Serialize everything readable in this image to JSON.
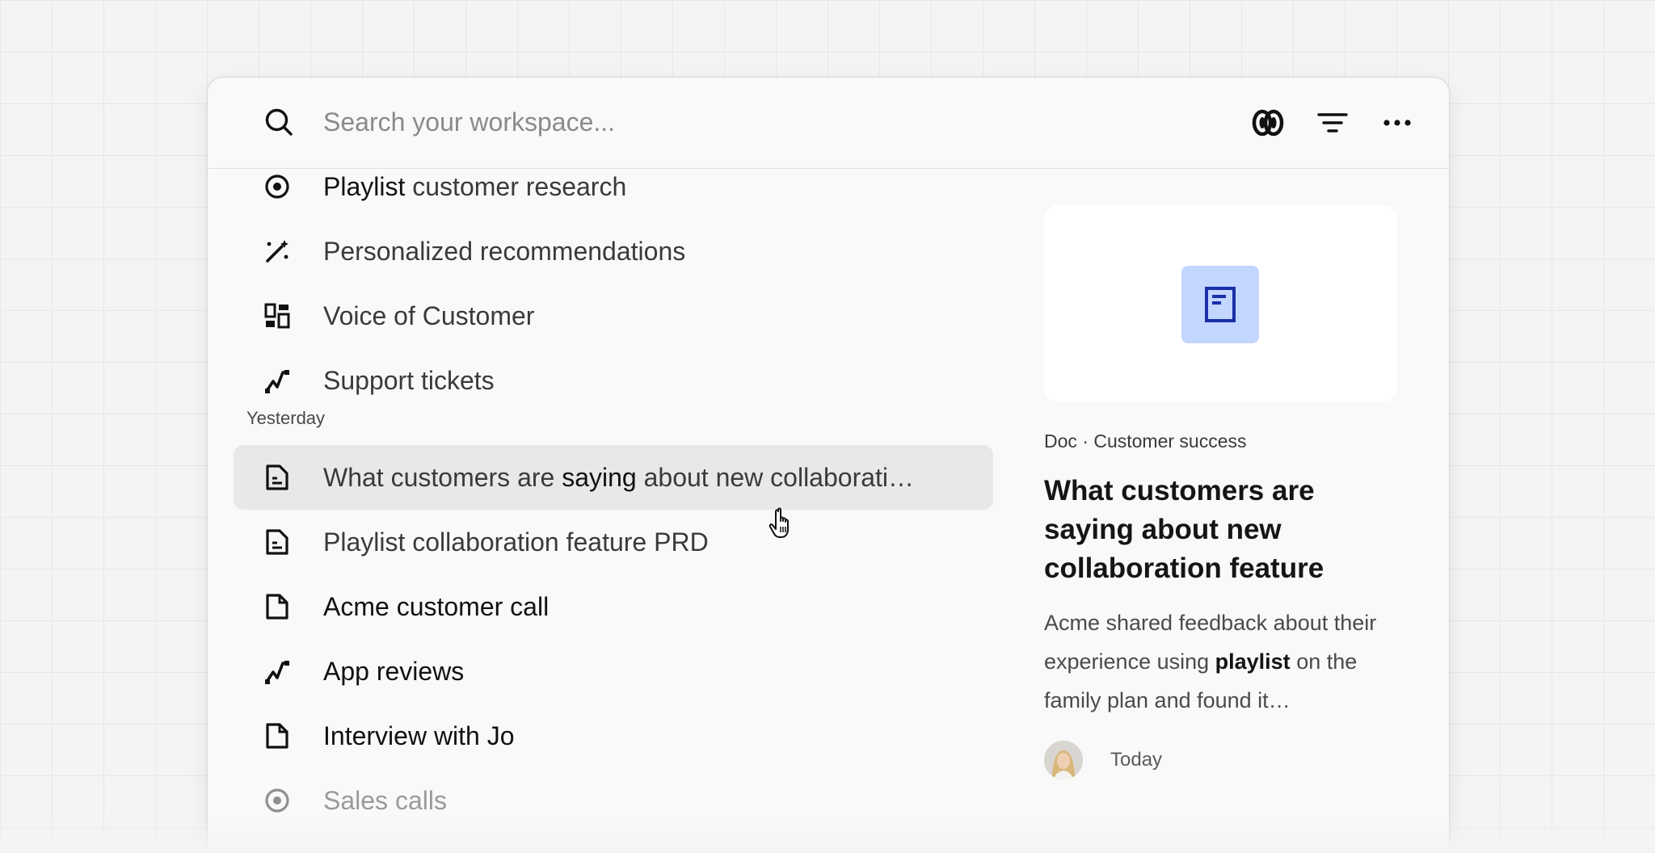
{
  "search": {
    "placeholder": "Search your workspace...",
    "value": ""
  },
  "toolbar": {
    "items": [
      {
        "icon": "ai-assistant-icon"
      },
      {
        "icon": "filter-icon"
      },
      {
        "icon": "more-icon"
      }
    ]
  },
  "results": {
    "top_items": [
      {
        "icon": "compass-icon",
        "label_bold": "Playlist",
        "label_rest": " customer research"
      },
      {
        "icon": "magic-wand-icon",
        "label": "Personalized recommendations"
      },
      {
        "icon": "dashboard-icon",
        "label": "Voice of Customer"
      },
      {
        "icon": "trend-icon",
        "label": "Support tickets"
      }
    ],
    "section_label": "Yesterday",
    "yesterday_items": [
      {
        "icon": "doc-lines-icon",
        "label_a": "What customers are ",
        "label_bold": "saying",
        "label_b": " about new collaborati…",
        "highlighted": true
      },
      {
        "icon": "doc-lines-icon",
        "label": "Playlist collaboration feature PRD"
      },
      {
        "icon": "doc-icon",
        "label": "Acme customer call"
      },
      {
        "icon": "trend-icon",
        "label": "App reviews"
      },
      {
        "icon": "doc-icon",
        "label": "Interview with Jo"
      },
      {
        "icon": "compass-icon",
        "label": "Sales calls"
      }
    ]
  },
  "preview": {
    "thumbnail_icon": "document-icon",
    "thumbnail_color": "#c3d6ff",
    "thumbnail_icon_color": "#1a2fa8",
    "meta": "Doc · Customer success",
    "title": "What customers are saying about new collaboration feature",
    "snippet_a": "Acme shared feedback about their experience using ",
    "snippet_bold": "playlist",
    "snippet_b": " on the family plan and found it…",
    "date": "Today"
  }
}
